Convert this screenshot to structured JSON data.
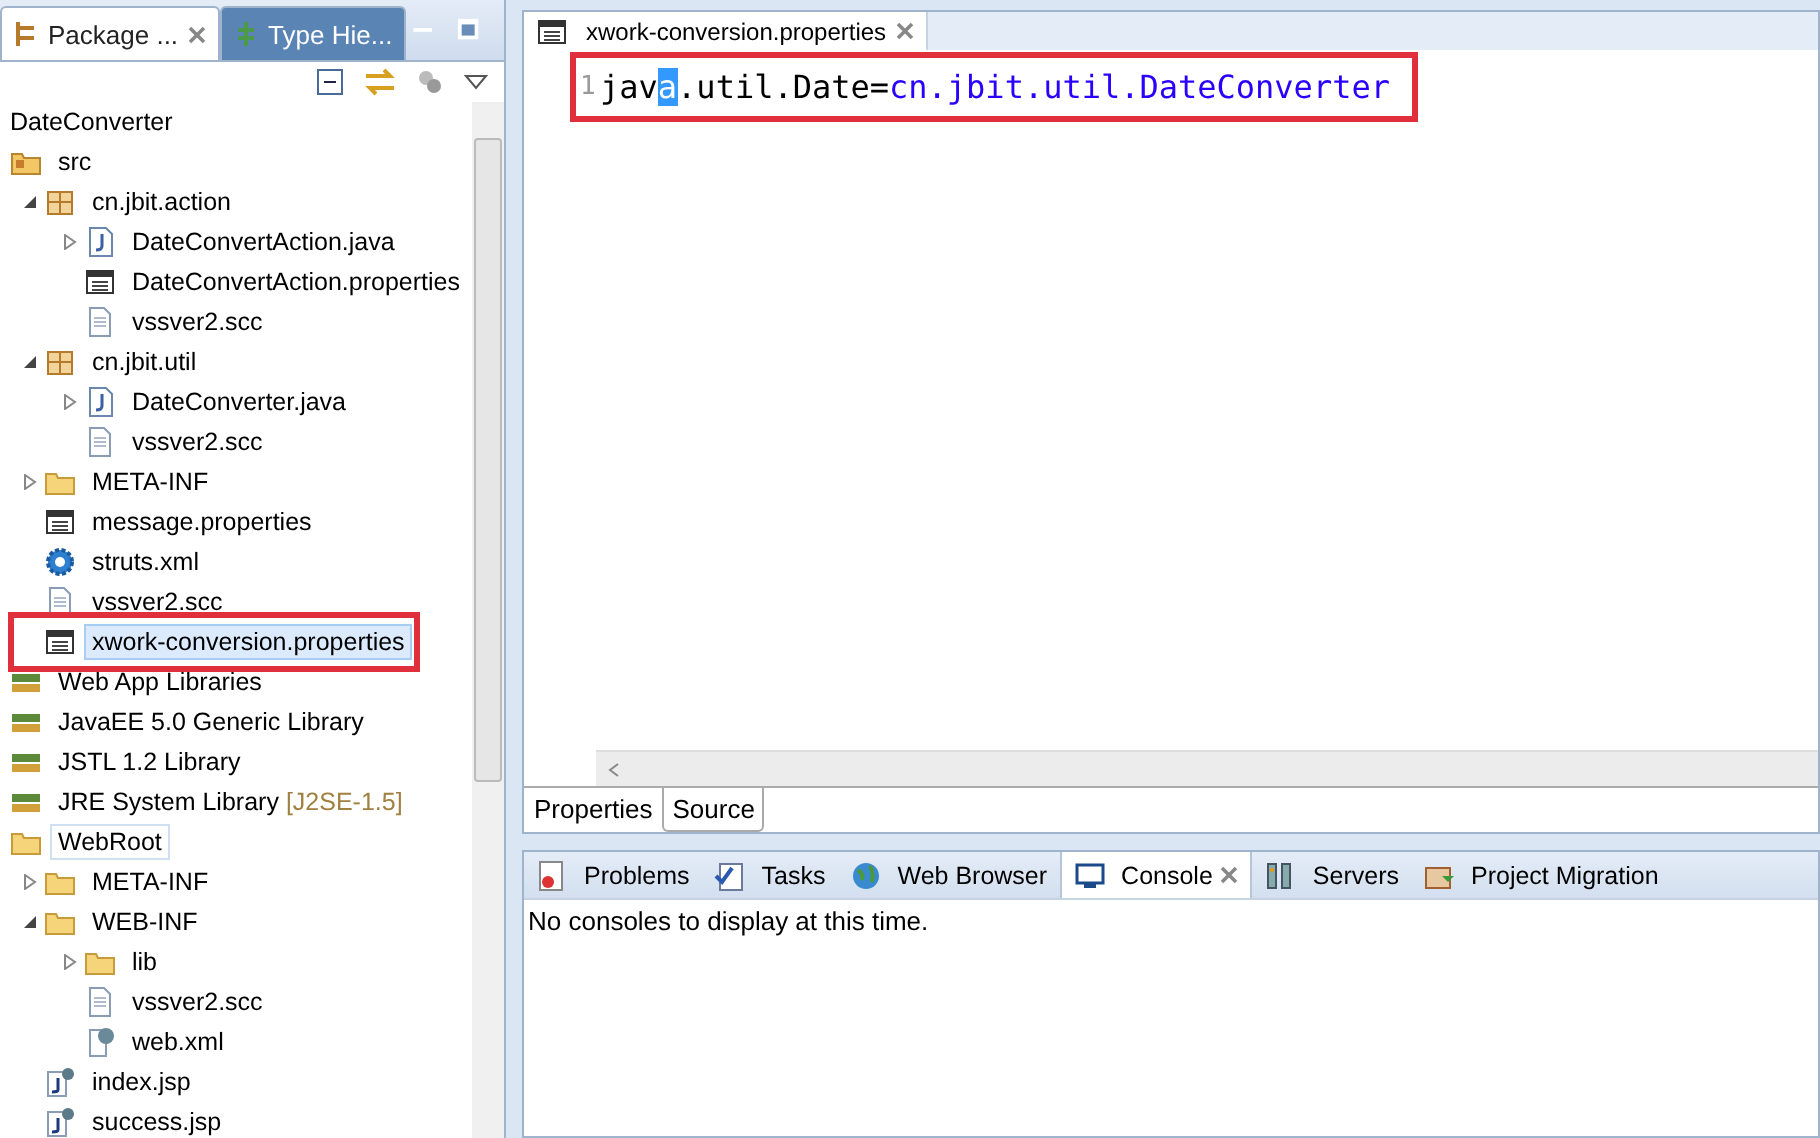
{
  "explorer": {
    "tabs": [
      {
        "label": "Package ...",
        "selected": true,
        "closable": true
      },
      {
        "label": "Type Hie...",
        "selected": false,
        "closable": false
      }
    ],
    "project": "DateConverter",
    "tree": [
      {
        "label": "src",
        "kind": "source-folder",
        "selected": false,
        "highlighted": false,
        "children": [
          {
            "label": "cn.jbit.action",
            "kind": "package",
            "expanded": true,
            "selected": false,
            "highlighted": false,
            "children": [
              {
                "label": "DateConvertAction.java",
                "kind": "java",
                "expanded": false,
                "selected": false,
                "highlighted": false
              },
              {
                "label": "DateConvertAction.properties",
                "kind": "properties",
                "selected": false,
                "highlighted": false
              },
              {
                "label": "vssver2.scc",
                "kind": "file",
                "selected": false,
                "highlighted": false
              }
            ]
          },
          {
            "label": "cn.jbit.util",
            "kind": "package",
            "expanded": true,
            "selected": false,
            "highlighted": false,
            "children": [
              {
                "label": "DateConverter.java",
                "kind": "java",
                "expanded": false,
                "selected": false,
                "highlighted": false
              },
              {
                "label": "vssver2.scc",
                "kind": "file",
                "selected": false,
                "highlighted": false
              }
            ]
          },
          {
            "label": "META-INF",
            "kind": "folder",
            "expanded": false,
            "selected": false,
            "highlighted": false
          },
          {
            "label": "message.properties",
            "kind": "properties",
            "selected": false,
            "highlighted": false
          },
          {
            "label": "struts.xml",
            "kind": "gear",
            "selected": false,
            "highlighted": false
          },
          {
            "label": "vssver2.scc",
            "kind": "file",
            "selected": false,
            "highlighted": false
          },
          {
            "label": "xwork-conversion.properties",
            "kind": "properties",
            "selected": true,
            "highlighted": true
          }
        ]
      },
      {
        "label": "Web App Libraries",
        "kind": "library",
        "selected": false,
        "highlighted": false
      },
      {
        "label": "JavaEE 5.0 Generic Library",
        "kind": "library",
        "selected": false,
        "highlighted": false
      },
      {
        "label": "JSTL 1.2 Library",
        "kind": "library",
        "selected": false,
        "highlighted": false
      },
      {
        "label": "JRE System Library",
        "decoration": "[J2SE-1.5]",
        "kind": "library",
        "selected": false,
        "highlighted": false
      },
      {
        "label": "WebRoot",
        "kind": "folder",
        "selected": false,
        "focused": true,
        "highlighted": false,
        "children": [
          {
            "label": "META-INF",
            "kind": "folder",
            "expanded": false,
            "selected": false,
            "highlighted": false
          },
          {
            "label": "WEB-INF",
            "kind": "folder",
            "expanded": true,
            "selected": false,
            "highlighted": false,
            "children": [
              {
                "label": "lib",
                "kind": "folder",
                "expanded": false,
                "selected": false,
                "highlighted": false
              },
              {
                "label": "vssver2.scc",
                "kind": "file",
                "selected": false,
                "highlighted": false
              },
              {
                "label": "web.xml",
                "kind": "webxml",
                "selected": false,
                "highlighted": false
              }
            ]
          },
          {
            "label": "index.jsp",
            "kind": "jsp",
            "selected": false,
            "highlighted": false
          },
          {
            "label": "success.jsp",
            "kind": "jsp",
            "selected": false,
            "highlighted": false
          }
        ]
      }
    ]
  },
  "editor": {
    "tab": "xwork-conversion.properties",
    "line_number": "1",
    "highlighted": true,
    "segments": [
      {
        "text": "jav",
        "kind": "key",
        "selected": false
      },
      {
        "text": "a",
        "kind": "key",
        "selected": true
      },
      {
        "text": ".util.Date=",
        "kind": "key",
        "selected": false
      },
      {
        "text": "cn.jbit.util.DateConverter",
        "kind": "value",
        "selected": false
      }
    ],
    "bottom_tabs": [
      {
        "label": "Properties",
        "selected": false
      },
      {
        "label": "Source",
        "selected": true
      }
    ]
  },
  "console": {
    "tabs": [
      {
        "label": "Problems",
        "kind": "problems",
        "selected": false
      },
      {
        "label": "Tasks",
        "kind": "tasks",
        "selected": false
      },
      {
        "label": "Web Browser",
        "kind": "globe",
        "selected": false
      },
      {
        "label": "Console",
        "kind": "console",
        "selected": true
      },
      {
        "label": "Servers",
        "kind": "servers",
        "selected": false
      },
      {
        "label": "Project Migration",
        "kind": "migration",
        "selected": false
      }
    ],
    "message": "No consoles to display at this time."
  }
}
